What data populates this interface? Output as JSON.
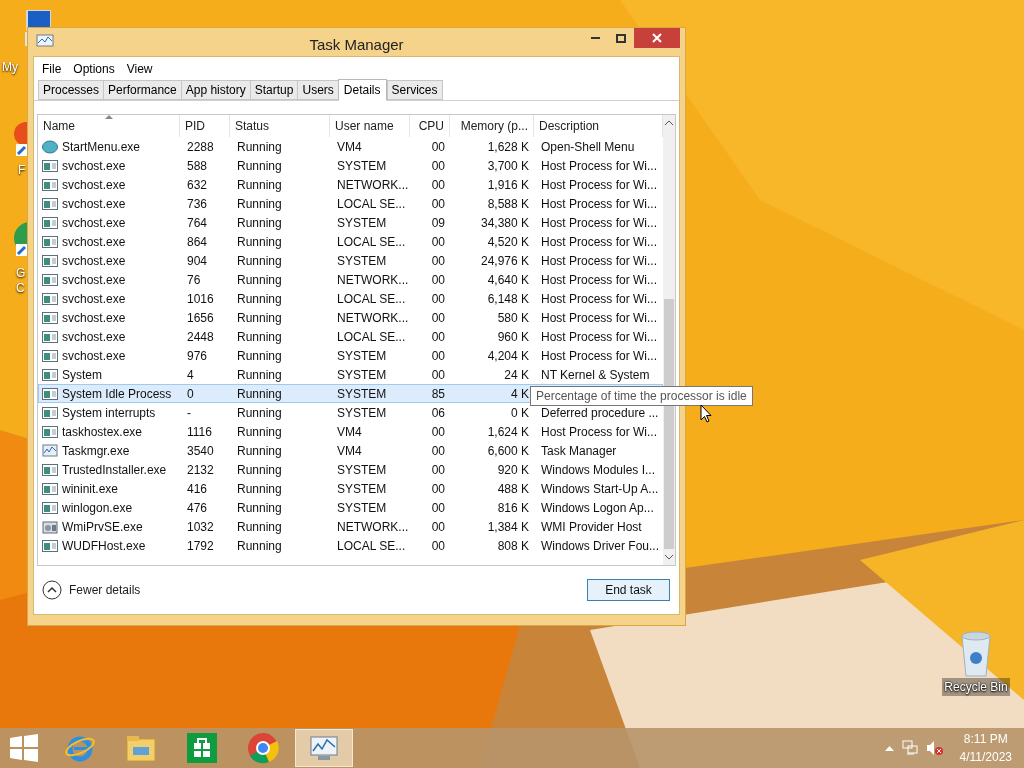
{
  "desktop_icons": [
    {
      "label": "My"
    },
    {
      "label": "F"
    },
    {
      "label": "G C"
    },
    {
      "label": "Recycle Bin"
    }
  ],
  "window": {
    "title": "Task Manager"
  },
  "menu": [
    "File",
    "Options",
    "View"
  ],
  "tabs": [
    {
      "label": "Processes",
      "selected": false
    },
    {
      "label": "Performance",
      "selected": false
    },
    {
      "label": "App history",
      "selected": false
    },
    {
      "label": "Startup",
      "selected": false
    },
    {
      "label": "Users",
      "selected": false
    },
    {
      "label": "Details",
      "selected": true
    },
    {
      "label": "Services",
      "selected": false
    }
  ],
  "table": {
    "columns": [
      {
        "label": "Name",
        "sorted": true
      },
      {
        "label": "PID",
        "sorted": false
      },
      {
        "label": "Status",
        "sorted": false
      },
      {
        "label": "User name",
        "sorted": false
      },
      {
        "label": "CPU",
        "sorted": false
      },
      {
        "label": "Memory (p...",
        "sorted": false
      },
      {
        "label": "Description",
        "sorted": false
      }
    ],
    "rows": [
      {
        "kind": "shell",
        "selected": false,
        "cells": [
          "StartMenu.exe",
          "2288",
          "Running",
          "VM4",
          "00",
          "1,628 K",
          "Open-Shell Menu"
        ]
      },
      {
        "kind": "app",
        "selected": false,
        "cells": [
          "svchost.exe",
          "588",
          "Running",
          "SYSTEM",
          "00",
          "3,700 K",
          "Host Process for Wi..."
        ]
      },
      {
        "kind": "app",
        "selected": false,
        "cells": [
          "svchost.exe",
          "632",
          "Running",
          "NETWORK...",
          "00",
          "1,916 K",
          "Host Process for Wi..."
        ]
      },
      {
        "kind": "app",
        "selected": false,
        "cells": [
          "svchost.exe",
          "736",
          "Running",
          "LOCAL SE...",
          "00",
          "8,588 K",
          "Host Process for Wi..."
        ]
      },
      {
        "kind": "app",
        "selected": false,
        "cells": [
          "svchost.exe",
          "764",
          "Running",
          "SYSTEM",
          "09",
          "34,380 K",
          "Host Process for Wi..."
        ]
      },
      {
        "kind": "app",
        "selected": false,
        "cells": [
          "svchost.exe",
          "864",
          "Running",
          "LOCAL SE...",
          "00",
          "4,520 K",
          "Host Process for Wi..."
        ]
      },
      {
        "kind": "app",
        "selected": false,
        "cells": [
          "svchost.exe",
          "904",
          "Running",
          "SYSTEM",
          "00",
          "24,976 K",
          "Host Process for Wi..."
        ]
      },
      {
        "kind": "app",
        "selected": false,
        "cells": [
          "svchost.exe",
          "76",
          "Running",
          "NETWORK...",
          "00",
          "4,640 K",
          "Host Process for Wi..."
        ]
      },
      {
        "kind": "app",
        "selected": false,
        "cells": [
          "svchost.exe",
          "1016",
          "Running",
          "LOCAL SE...",
          "00",
          "6,148 K",
          "Host Process for Wi..."
        ]
      },
      {
        "kind": "app",
        "selected": false,
        "cells": [
          "svchost.exe",
          "1656",
          "Running",
          "NETWORK...",
          "00",
          "580 K",
          "Host Process for Wi..."
        ]
      },
      {
        "kind": "app",
        "selected": false,
        "cells": [
          "svchost.exe",
          "2448",
          "Running",
          "LOCAL SE...",
          "00",
          "960 K",
          "Host Process for Wi..."
        ]
      },
      {
        "kind": "app",
        "selected": false,
        "cells": [
          "svchost.exe",
          "976",
          "Running",
          "SYSTEM",
          "00",
          "4,204 K",
          "Host Process for Wi..."
        ]
      },
      {
        "kind": "app",
        "selected": false,
        "cells": [
          "System",
          "4",
          "Running",
          "SYSTEM",
          "00",
          "24 K",
          "NT Kernel & System"
        ]
      },
      {
        "kind": "app",
        "selected": true,
        "cells": [
          "System Idle Process",
          "0",
          "Running",
          "SYSTEM",
          "85",
          "4 K"
        ]
      },
      {
        "kind": "app",
        "selected": false,
        "cells": [
          "System interrupts",
          "-",
          "Running",
          "SYSTEM",
          "06",
          "0 K",
          "Deferred procedure ..."
        ]
      },
      {
        "kind": "app",
        "selected": false,
        "cells": [
          "taskhostex.exe",
          "1116",
          "Running",
          "VM4",
          "00",
          "1,624 K",
          "Host Process for Wi..."
        ]
      },
      {
        "kind": "monitor",
        "selected": false,
        "cells": [
          "Taskmgr.exe",
          "3540",
          "Running",
          "VM4",
          "00",
          "6,600 K",
          "Task Manager"
        ]
      },
      {
        "kind": "app",
        "selected": false,
        "cells": [
          "TrustedInstaller.exe",
          "2132",
          "Running",
          "SYSTEM",
          "00",
          "920 K",
          "Windows Modules I..."
        ]
      },
      {
        "kind": "app",
        "selected": false,
        "cells": [
          "wininit.exe",
          "416",
          "Running",
          "SYSTEM",
          "00",
          "488 K",
          "Windows Start-Up A..."
        ]
      },
      {
        "kind": "app",
        "selected": false,
        "cells": [
          "winlogon.exe",
          "476",
          "Running",
          "SYSTEM",
          "00",
          "816 K",
          "Windows Logon Ap..."
        ]
      },
      {
        "kind": "tools",
        "selected": false,
        "cells": [
          "WmiPrvSE.exe",
          "1032",
          "Running",
          "NETWORK...",
          "00",
          "1,384 K",
          "WMI Provider Host"
        ]
      },
      {
        "kind": "app",
        "selected": false,
        "cells": [
          "WUDFHost.exe",
          "1792",
          "Running",
          "LOCAL SE...",
          "00",
          "808 K",
          "Windows Driver Fou..."
        ]
      }
    ]
  },
  "tooltip": "Percentage of time the processor is idle",
  "footer": {
    "toggle": "Fewer details",
    "button": "End task"
  },
  "taskbar": {
    "apps": [
      {
        "kind": "ie",
        "active": false
      },
      {
        "kind": "explorer",
        "active": false
      },
      {
        "kind": "store",
        "active": false
      },
      {
        "kind": "chrome",
        "active": false
      },
      {
        "kind": "taskmgr",
        "active": true
      }
    ],
    "time": "8:11 PM",
    "date": "4/11/2023"
  }
}
